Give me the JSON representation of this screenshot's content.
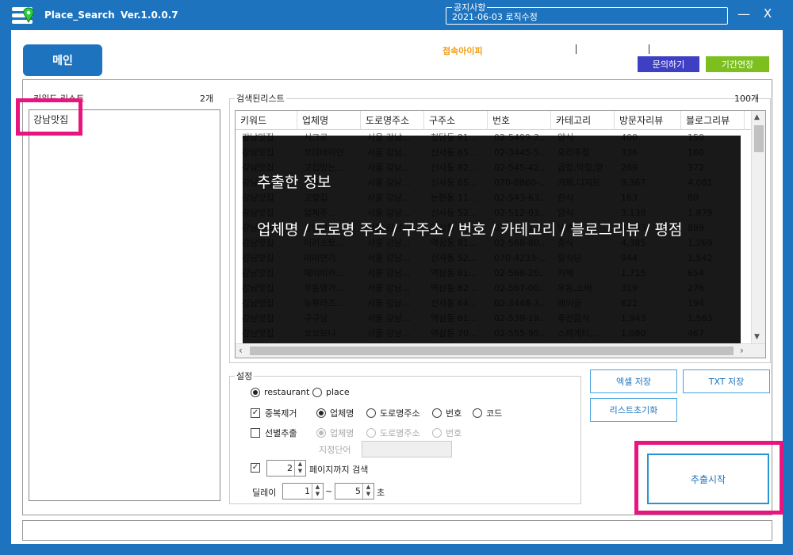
{
  "window": {
    "app_name": "Place_Search",
    "version": "Ver.1.0.0.7",
    "notice_label": "공지사항",
    "notice_text": "2021-06-03 로직수정",
    "minimize": "—",
    "close": "X"
  },
  "header": {
    "main_tab": "메인",
    "connection_ip_label": "접속아이피",
    "inquiry_button": "문의하기",
    "extend_button": "기간연장"
  },
  "keywords": {
    "title": "키워드 리스트",
    "count": "2개",
    "items": [
      "강남맛집"
    ]
  },
  "results": {
    "title": "검색된리스트",
    "count": "100개",
    "columns": [
      "키워드",
      "업체명",
      "도로명주소",
      "구주소",
      "번호",
      "카테고리",
      "방문자리뷰",
      "블로그리뷰"
    ],
    "rows": [
      [
        "강남맛집",
        "서그로",
        "서울 강남...",
        "청담동 81...",
        "02-5499-3...",
        "양식",
        "400",
        "150"
      ],
      [
        "강남맛집",
        "코타바이언",
        "서울 강남...",
        "신사동 65...",
        "02-3445-5...",
        "요리주점",
        "336",
        "160"
      ],
      [
        "강남맛집",
        "고집있는...",
        "서울 강남...",
        "신사동 82...",
        "02-545-42...",
        "곱창,막창,양",
        "269",
        "372"
      ],
      [
        "강남맛집",
        "아우...",
        "서울 강남...",
        "신사동 65...",
        "070-8860-...",
        "카페,디저트",
        "9,367",
        "4,081"
      ],
      [
        "강남맛집",
        "고향집",
        "서울 강남...",
        "논현동 11...",
        "02-543-63...",
        "한식",
        "163",
        "80"
      ],
      [
        "강남맛집",
        "업체주...",
        "서울 강남...",
        "신사동 52...",
        "02-512-03...",
        "양식",
        "3,138",
        "1,879"
      ],
      [
        "강남맛집",
        "강남면옥",
        "서울 강남...",
        "역삼동 82...",
        "02-555-13...",
        "냉면",
        "4,103",
        "889"
      ],
      [
        "강남맛집",
        "이키소토...",
        "서울 강남...",
        "역삼동 81...",
        "02-568-80...",
        "중식",
        "4,385",
        "1,269"
      ],
      [
        "강남맛집",
        "미미면가",
        "서울 강남...",
        "신사동 52...",
        "070-4233-...",
        "일식당",
        "944",
        "1,542"
      ],
      [
        "강남맛집",
        "에이비카...",
        "서울 강남...",
        "역삼동 61...",
        "02-566-20...",
        "카페",
        "1,715",
        "654"
      ],
      [
        "강남맛집",
        "우동명가...",
        "서울 강남...",
        "역삼동 82...",
        "02-567-00...",
        "우동,소바",
        "319",
        "276"
      ],
      [
        "강남맛집",
        "뉴욕라즈...",
        "서울 강남...",
        "신사동 64...",
        "02-3448-7...",
        "베이글",
        "622",
        "194"
      ],
      [
        "강남맛집",
        "구구당",
        "서울 강남...",
        "역삼동 61...",
        "02-539-19...",
        "퓨전음식",
        "1,943",
        "1,563"
      ],
      [
        "강남맛집",
        "코코브니",
        "서울 강남...",
        "역삼동 70...",
        "02-555-95...",
        "스파게티,...",
        "1,080",
        "467"
      ]
    ]
  },
  "overlay": {
    "title": "추출한 정보",
    "description": "업체명 / 도로명 주소 / 구주소 / 번호 / 카테고리 / 블로그리뷰 / 평점"
  },
  "settings": {
    "title": "설정",
    "mode_restaurant": "restaurant",
    "mode_place": "place",
    "dedupe_label": "중복제거",
    "dedupe_opt1": "업체명",
    "dedupe_opt2": "도로명주소",
    "dedupe_opt3": "번호",
    "dedupe_opt4": "코드",
    "select_label": "선별추출",
    "select_opt1": "업체명",
    "select_opt2": "도로명주소",
    "select_opt3": "번호",
    "keyword_label": "지정단어",
    "pages_value": "2",
    "pages_label": "페이지까지 검색",
    "delay_label": "딜레이",
    "delay_min": "1",
    "delay_tilde": "~",
    "delay_max": "5",
    "delay_unit": "초"
  },
  "actions": {
    "excel_save": "엑셀 저장",
    "txt_save": "TXT 저장",
    "reset_list": "리스트초기화",
    "start": "추출시작"
  },
  "colors": {
    "brand_blue": "#1e73be",
    "highlight_pink": "#e8157e",
    "inquiry_purple": "#3f3fc4",
    "extend_green": "#7cbf1f",
    "ip_orange": "#f39c12"
  }
}
